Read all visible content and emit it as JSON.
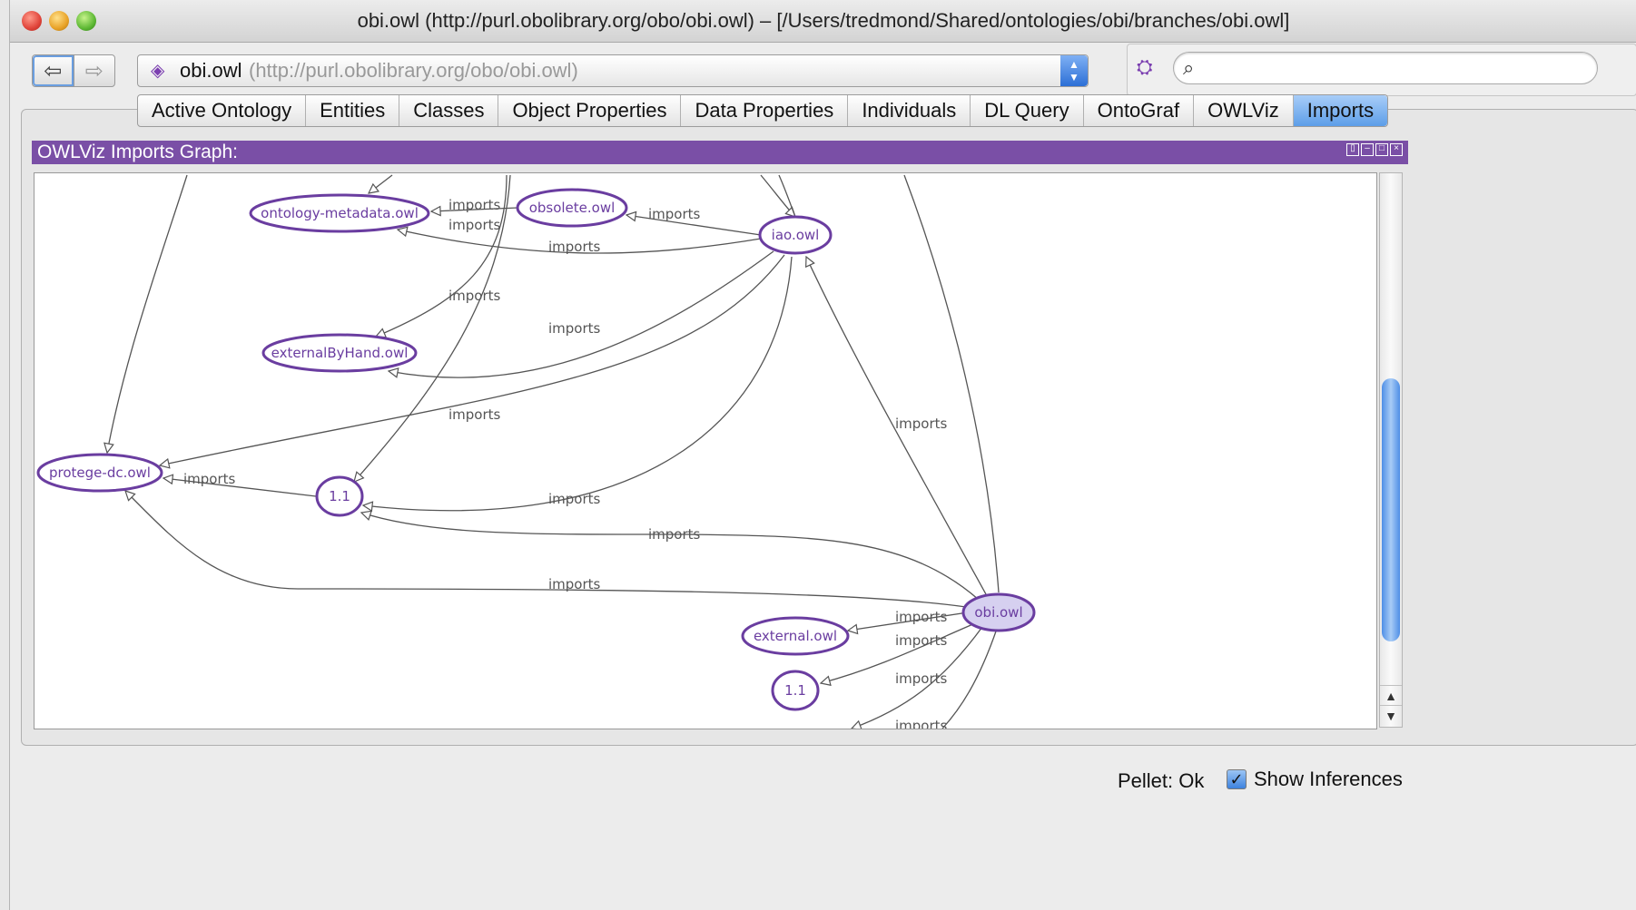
{
  "window": {
    "title": "obi.owl (http://purl.obolibrary.org/obo/obi.owl) – [/Users/tredmond/Shared/ontologies/obi/branches/obi.owl]"
  },
  "toolbar": {
    "back_icon": "back-arrow-icon",
    "forward_icon": "forward-arrow-icon",
    "ontology_name": "obi.owl",
    "ontology_iri": "(http://purl.obolibrary.org/obo/obi.owl)",
    "search_placeholder": ""
  },
  "tabs": [
    {
      "label": "Active Ontology",
      "active": false
    },
    {
      "label": "Entities",
      "active": false
    },
    {
      "label": "Classes",
      "active": false
    },
    {
      "label": "Object Properties",
      "active": false
    },
    {
      "label": "Data Properties",
      "active": false
    },
    {
      "label": "Individuals",
      "active": false
    },
    {
      "label": "DL Query",
      "active": false
    },
    {
      "label": "OntoGraf",
      "active": false
    },
    {
      "label": "OWLViz",
      "active": false
    },
    {
      "label": "Imports",
      "active": true
    }
  ],
  "view": {
    "title": "OWLViz Imports Graph:"
  },
  "graph": {
    "edge_label": "imports",
    "nodes": {
      "ontology_metadata": "ontology-metadata.owl",
      "obsolete": "obsolete.owl",
      "iao": "iao.owl",
      "external_by_hand": "externalByHand.owl",
      "protege_dc": "protege-dc.owl",
      "v11_top": "1.1",
      "obi": "obi.owl",
      "external": "external.owl",
      "v11_bottom": "1.1"
    },
    "colors": {
      "node_stroke": "#6a3da0",
      "selected_fill": "#d6d0f0",
      "edge": "#555555"
    }
  },
  "status": {
    "reasoner": "Pellet: Ok",
    "show_inferences_label": "Show Inferences",
    "show_inferences_checked": true
  }
}
